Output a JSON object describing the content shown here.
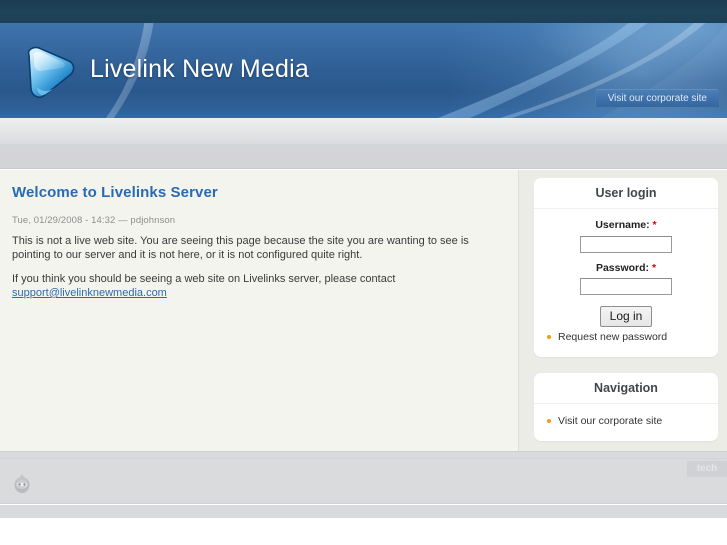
{
  "site": {
    "title": "Livelink New Media",
    "logo_icon": "blue-shield-logo",
    "corporate_button": "Visit our corporate site"
  },
  "colors": {
    "topstrip": "#1e4459",
    "header_blue": "#2f5f95",
    "accent_link": "#2a6ab0",
    "bullet_orange": "#f19c1a",
    "required_red": "#e00000",
    "content_bg": "#f4f4ef",
    "sidebar_bg": "#ebece6",
    "footer_bg": "#dadbdd"
  },
  "main": {
    "page_title": "Welcome to Livelinks Server",
    "submitted": "Tue, 01/29/2008 - 14:32 — pdjohnson",
    "paragraph_1": "This is not a live web site. You are seeing this page because the site you are wanting to see is pointing to our server and it is not here, or it is not configured quite right.",
    "paragraph_2_prefix": "If you think you should be seeing a web site on Livelinks server, please contact ",
    "support_email": "support@livelinknewmedia.com"
  },
  "sidebar": {
    "login_block": {
      "title": "User login",
      "username_label": "Username:",
      "username_value": "",
      "username_placeholder": "",
      "password_label": "Password:",
      "password_value": "",
      "password_placeholder": "",
      "required_marker": "*",
      "submit_label": "Log in",
      "links": [
        {
          "label": "Request new password"
        }
      ]
    },
    "navigation_block": {
      "title": "Navigation",
      "links": [
        {
          "label": "Visit our corporate site"
        }
      ]
    }
  },
  "footer": {
    "icon": "drupal-drop-icon",
    "badge": "tech"
  }
}
